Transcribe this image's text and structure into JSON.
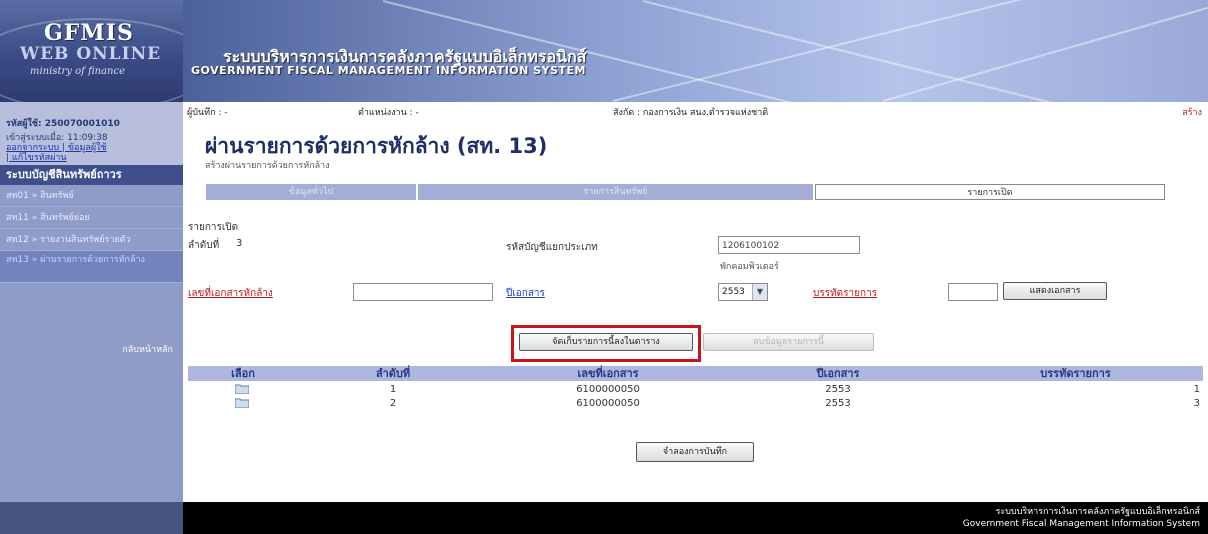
{
  "brand": {
    "logo_line1": "GFMIS",
    "logo_line2": "WEB ONLINE",
    "logo_line3": "ministry of finance",
    "title_th": "ระบบบริหารการเงินการคลังภาครัฐแบบอิเล็กทรอนิกส์",
    "title_en": "GOVERNMENT FISCAL MANAGEMENT INFORMATION SYSTEM"
  },
  "sidebar": {
    "user_code": "รหัสผู้ใช้: 250070001010",
    "login_time": "เข้าสู่ระบบเมื่อ: 11:09:38",
    "links_line1": "ออกจากระบบ | ข้อมูลผู้ใช้",
    "links_line2": "| แก้ไขรหัสผ่าน",
    "section_title": "ระบบบัญชีสินทรัพย์ถาวร",
    "items": [
      {
        "label": "สท01 » สินทรัพย์"
      },
      {
        "label": "สท11 » สินทรัพย์ย่อย"
      },
      {
        "label": "สท12 » รายงานสินทรัพย์รายตัว"
      },
      {
        "label": "สท13 » ผ่านรายการด้วยการหักล้าง"
      }
    ],
    "home_link": "กลับหน้าหลัก"
  },
  "topbar": {
    "recorder": "ผู้บันทึก : -",
    "position": "ตำแหน่งงาน : -",
    "affiliation": "สังกัด : กองการเงิน สนง.ตำรวจแห่งชาติ",
    "right_link": "สร้าง"
  },
  "page": {
    "title": "ผ่านรายการด้วยการหักล้าง (สท. 13)",
    "subtitle": "สร้างผ่านรายการด้วยการหักล้าง"
  },
  "tabs": [
    {
      "label": "ข้อมูลทั่วไป"
    },
    {
      "label": "รายการสินทรัพย์"
    },
    {
      "label": "รายการเปิด"
    }
  ],
  "form": {
    "section_title": "รายการเปิด",
    "seq_label": "ลำดับที่",
    "seq_value": "3",
    "gl_label": "รหัสบัญชีแยกประเภท",
    "gl_value": "1206100102",
    "gl_note": "พักคอมพิวเตอร์",
    "doc_no_label": "เลขที่เอกสารหักล้าง",
    "doc_no_value": "",
    "doc_year_label": "ปีเอกสาร",
    "doc_year_value": "2553",
    "line_label": "บรรทัดรายการ",
    "line_value": "",
    "show_doc_button": "แสดงเอกสาร",
    "save_row_button": "จัดเก็บรายการนี้ลงในตาราง",
    "delete_row_button": "ลบข้อมูลรายการนี้"
  },
  "table": {
    "headers": [
      "เลือก",
      "ลำดับที่",
      "เลขที่เอกสาร",
      "ปีเอกสาร",
      "บรรทัดรายการ"
    ],
    "rows": [
      {
        "seq": "1",
        "doc_no": "6100000050",
        "year": "2553",
        "line": "1"
      },
      {
        "seq": "2",
        "doc_no": "6100000050",
        "year": "2553",
        "line": "3"
      }
    ]
  },
  "simulate_button": "จำลองการบันทึก",
  "footer": {
    "th": "ระบบบริหารการเงินการคลังภาครัฐแบบอิเล็กทรอนิกส์",
    "en": "Government Fiscal Management Information System"
  },
  "colors": {
    "accent": "#233a88",
    "highlight": "#c8141b"
  }
}
